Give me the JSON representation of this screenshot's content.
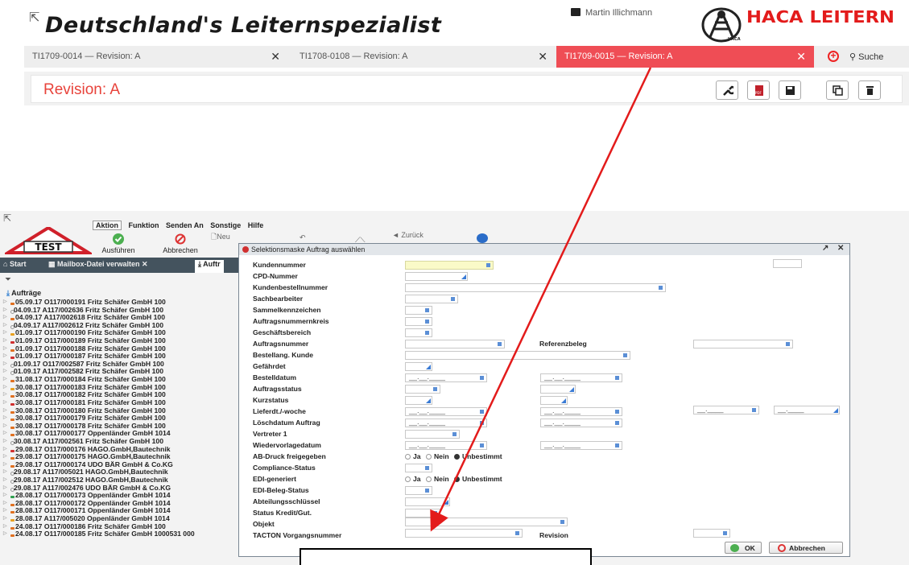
{
  "header": {
    "brand": "Deutschland's Leiternspezialist",
    "user_name": "Martin Illichmann",
    "logo_text": "HACA LEITERN",
    "logo_badge_text": "HACA",
    "tabs": [
      {
        "label": "TI1709-0014 — Revision: A"
      },
      {
        "label": "TI1708-0108 — Revision: A"
      },
      {
        "label": "TI1709-0015 — Revision: A"
      }
    ],
    "search_label": "Suche",
    "revision_title": "Revision: A",
    "pdf_icon_text": "PDF"
  },
  "app": {
    "test_sign": "TEST",
    "menu": [
      "Aktion",
      "Funktion",
      "Senden An",
      "Sonstige",
      "Hilfe"
    ],
    "ribbon": {
      "ausfuehren": "Ausführen",
      "abbrechen": "Abbrechen",
      "neu": "Neu",
      "zurueck": "Zurück"
    },
    "tabs": {
      "start": "Start",
      "mailbox": "Mailbox-Datei verwalten",
      "auftr": "Auftr"
    },
    "tree_title": "Aufträge",
    "orders": [
      {
        "text": "05.09.17 O117/000191 Fritz Schäfer GmbH 100",
        "c": "#e07020"
      },
      {
        "text": "04.09.17 A117/002636 Fritz Schäfer GmbH 100",
        "c": ""
      },
      {
        "text": "04.09.17 A117/002618 Fritz Schäfer GmbH 100",
        "c": "#e07020"
      },
      {
        "text": "04.09.17 A117/002612 Fritz Schäfer GmbH 100",
        "c": ""
      },
      {
        "text": "01.09.17 O117/000190 Fritz Schäfer GmbH 100",
        "c": "#e8a020"
      },
      {
        "text": "01.09.17 O117/000189 Fritz Schäfer GmbH 100",
        "c": "#d03030"
      },
      {
        "text": "01.09.17 O117/000188 Fritz Schäfer GmbH 100",
        "c": "#e07020"
      },
      {
        "text": "01.09.17 O117/000187 Fritz Schäfer GmbH 100",
        "c": "#d03030"
      },
      {
        "text": "01.09.17 O117/002587 Fritz Schäfer GmbH 100",
        "c": ""
      },
      {
        "text": "01.09.17 A117/002582 Fritz Schäfer GmbH 100",
        "c": ""
      },
      {
        "text": "31.08.17 O117/000184 Fritz Schäfer GmbH 100",
        "c": "#e07020"
      },
      {
        "text": "30.08.17 O117/000183 Fritz Schäfer GmbH 100",
        "c": "#e8a020"
      },
      {
        "text": "30.08.17 O117/000182 Fritz Schäfer GmbH 100",
        "c": "#e07020"
      },
      {
        "text": "30.08.17 O117/000181 Fritz Schäfer GmbH 100",
        "c": "#d03030"
      },
      {
        "text": "30.08.17 O117/000180 Fritz Schäfer GmbH 100",
        "c": "#e07020"
      },
      {
        "text": "30.08.17 O117/000179 Fritz Schäfer GmbH 100",
        "c": "#e07020"
      },
      {
        "text": "30.08.17 O117/000178 Fritz Schäfer GmbH 100",
        "c": "#e07020"
      },
      {
        "text": "30.08.17 O117/000177 Oppenländer GmbH 1014",
        "c": "#e07020"
      },
      {
        "text": "30.08.17 A117/002561 Fritz Schäfer GmbH 100",
        "c": ""
      },
      {
        "text": "29.08.17 O117/000176 HAGO.GmbH,Bautechnik",
        "c": "#d03030"
      },
      {
        "text": "29.08.17 O117/000175 HAGO.GmbH,Bautechnik",
        "c": "#e07020"
      },
      {
        "text": "29.08.17 O117/000174 UDO BÄR GmbH & Co.KG",
        "c": "#e07020"
      },
      {
        "text": "29.08.17 A117/005021 HAGO.GmbH,Bautechnik",
        "c": ""
      },
      {
        "text": "29.08.17 A117/002512 HAGO.GmbH,Bautechnik",
        "c": ""
      },
      {
        "text": "29.08.17 A117/002476 UDO BÄR GmbH & Co.KG",
        "c": ""
      },
      {
        "text": "28.08.17 O117/000173 Oppenländer GmbH 1014",
        "c": "#30a050"
      },
      {
        "text": "28.08.17 O117/000172 Oppenländer GmbH 1014",
        "c": "#e07020"
      },
      {
        "text": "28.08.17 O117/000171 Oppenländer GmbH 1014",
        "c": "#e07020"
      },
      {
        "text": "28.08.17 A117/005020 Oppenländer GmbH 1014",
        "c": "#e8a020"
      },
      {
        "text": "24.08.17 O117/000186 Fritz Schäfer GmbH 100",
        "c": "#e07020"
      },
      {
        "text": "24.08.17 O117/000185 Fritz Schäfer GmbH 1000531 000",
        "c": "#e07020"
      }
    ]
  },
  "dialog": {
    "title": "Selektionsmaske Auftrag auswählen",
    "fields": {
      "kundennummer": "Kundennummer",
      "cpd": "CPD-Nummer",
      "kundenbestell": "Kundenbestellnummer",
      "sachbearbeiter": "Sachbearbeiter",
      "sammel": "Sammelkennzeichen",
      "auftragskreis": "Auftragsnummernkreis",
      "geschaeft": "Geschäftsbereich",
      "auftragsnummer": "Auftragsnummer",
      "referenzbeleg": "Referenzbeleg",
      "bestellang": "Bestellang. Kunde",
      "gefaehrdet": "Gefährdet",
      "bestelldatum": "Bestelldatum",
      "auftragsstatus": "Auftragsstatus",
      "kurzstatus": "Kurzstatus",
      "lieferdt": "Lieferdt./-woche",
      "loeschdatum": "Löschdatum Auftrag",
      "vertreter": "Vertreter 1",
      "wiedervorlage": "Wiedervorlagedatum",
      "abdruck": "AB-Druck freigegeben",
      "compliance": "Compliance-Status",
      "edigen": "EDI-generiert",
      "edibeleg": "EDI-Beleg-Status",
      "abteilung": "Abteilungsschlüssel",
      "statuskredit": "Status Kredit/Gut.",
      "objekt": "Objekt",
      "tacton": "TACTON Vorgangsnummer",
      "revision": "Revision"
    },
    "radio": {
      "ja": "Ja",
      "nein": "Nein",
      "unbestimmt": "Unbestimmt"
    },
    "date_placeholder": "__.__.____",
    "week_placeholder": "__.____",
    "ok_label": "OK",
    "cancel_label": "Abbrechen"
  },
  "colors": {
    "accent": "#ef4d55",
    "revision_red": "#e8433b",
    "app_tab_bar": "#44535e",
    "field_toggle": "#3a7bd5",
    "arrow": "#e31b1b"
  }
}
